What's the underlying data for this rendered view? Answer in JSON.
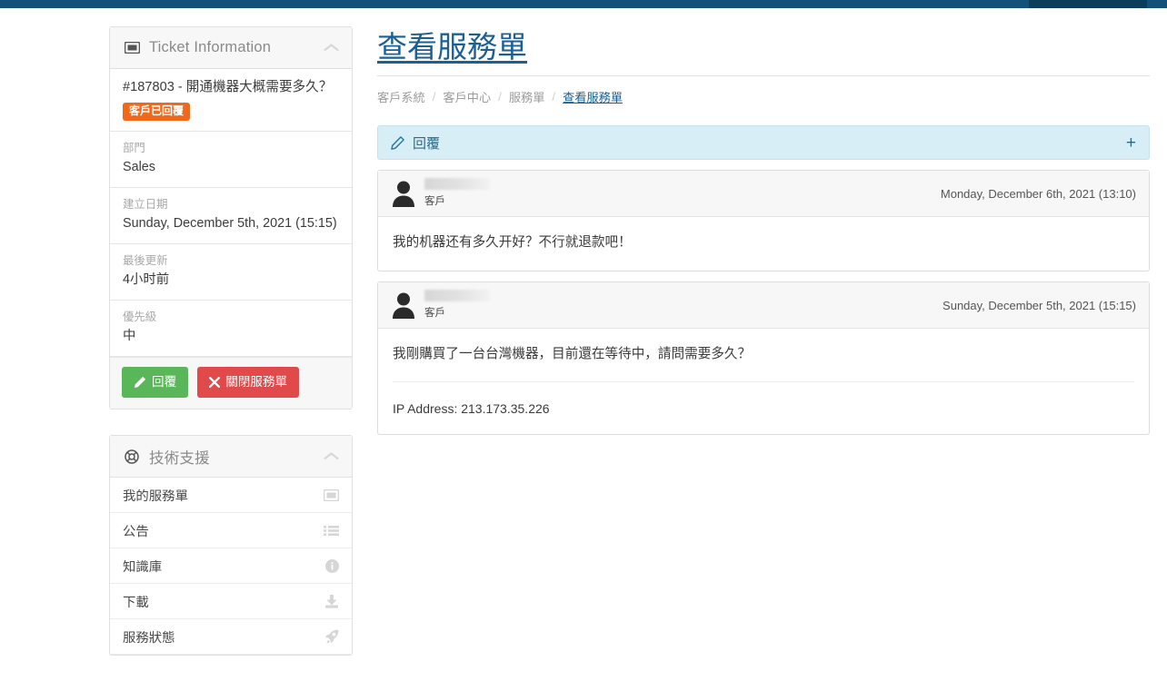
{
  "topbar": {
    "accent_color": "#145179",
    "accent_dark_color": "#0c3e5c"
  },
  "sidebar": {
    "ticket_panel": {
      "title": "Ticket Information",
      "icon": "ticket-icon",
      "collapse_icon": "chevron-up-icon",
      "ticket_title": "#187803 - 開通機器大概需要多久？",
      "status_badge": "客戶已回覆",
      "badge_color": "#f0691a",
      "fields": [
        {
          "label": "部門",
          "value": "Sales"
        },
        {
          "label": "建立日期",
          "value": "Sunday, December 5th, 2021 (15:15)"
        },
        {
          "label": "最後更新",
          "value": "4小时前"
        },
        {
          "label": "優先級",
          "value": "中"
        }
      ],
      "reply_button": "回覆",
      "reply_button_color": "#59b659",
      "close_button": "關閉服務單",
      "close_button_color": "#e04a4a"
    },
    "support_panel": {
      "title": "技術支援",
      "icon": "life-ring-icon",
      "collapse_icon": "chevron-up-icon",
      "items": [
        {
          "label": "我的服務單",
          "icon": "ticket-icon"
        },
        {
          "label": "公告",
          "icon": "list-icon"
        },
        {
          "label": "知識庫",
          "icon": "info-circle-icon"
        },
        {
          "label": "下載",
          "icon": "download-icon"
        },
        {
          "label": "服務狀態",
          "icon": "rocket-icon"
        }
      ]
    }
  },
  "main": {
    "page_title": "查看服務單",
    "title_color": "#1a6094",
    "breadcrumb": [
      "客戶系統",
      "客戶中心",
      "服務單",
      "查看服務單"
    ],
    "breadcrumb_separator": "/",
    "reply_bar": {
      "label": "回覆",
      "icon": "pencil-icon",
      "expand_icon": "plus-icon"
    },
    "messages": [
      {
        "author": "",
        "author_redacted": true,
        "role": "客戶",
        "avatar": "user-avatar-icon",
        "timestamp": "Monday, December 6th, 2021 (13:10)",
        "text": "我的机器还有多久开好？不行就退款吧！",
        "ip_address": ""
      },
      {
        "author": "",
        "author_redacted": true,
        "role": "客戶",
        "avatar": "user-avatar-icon",
        "timestamp": "Sunday, December 5th, 2021 (15:15)",
        "text": "我剛購買了一台台灣機器，目前還在等待中，請問需要多久？",
        "ip_address": "IP Address: 213.173.35.226"
      }
    ]
  }
}
